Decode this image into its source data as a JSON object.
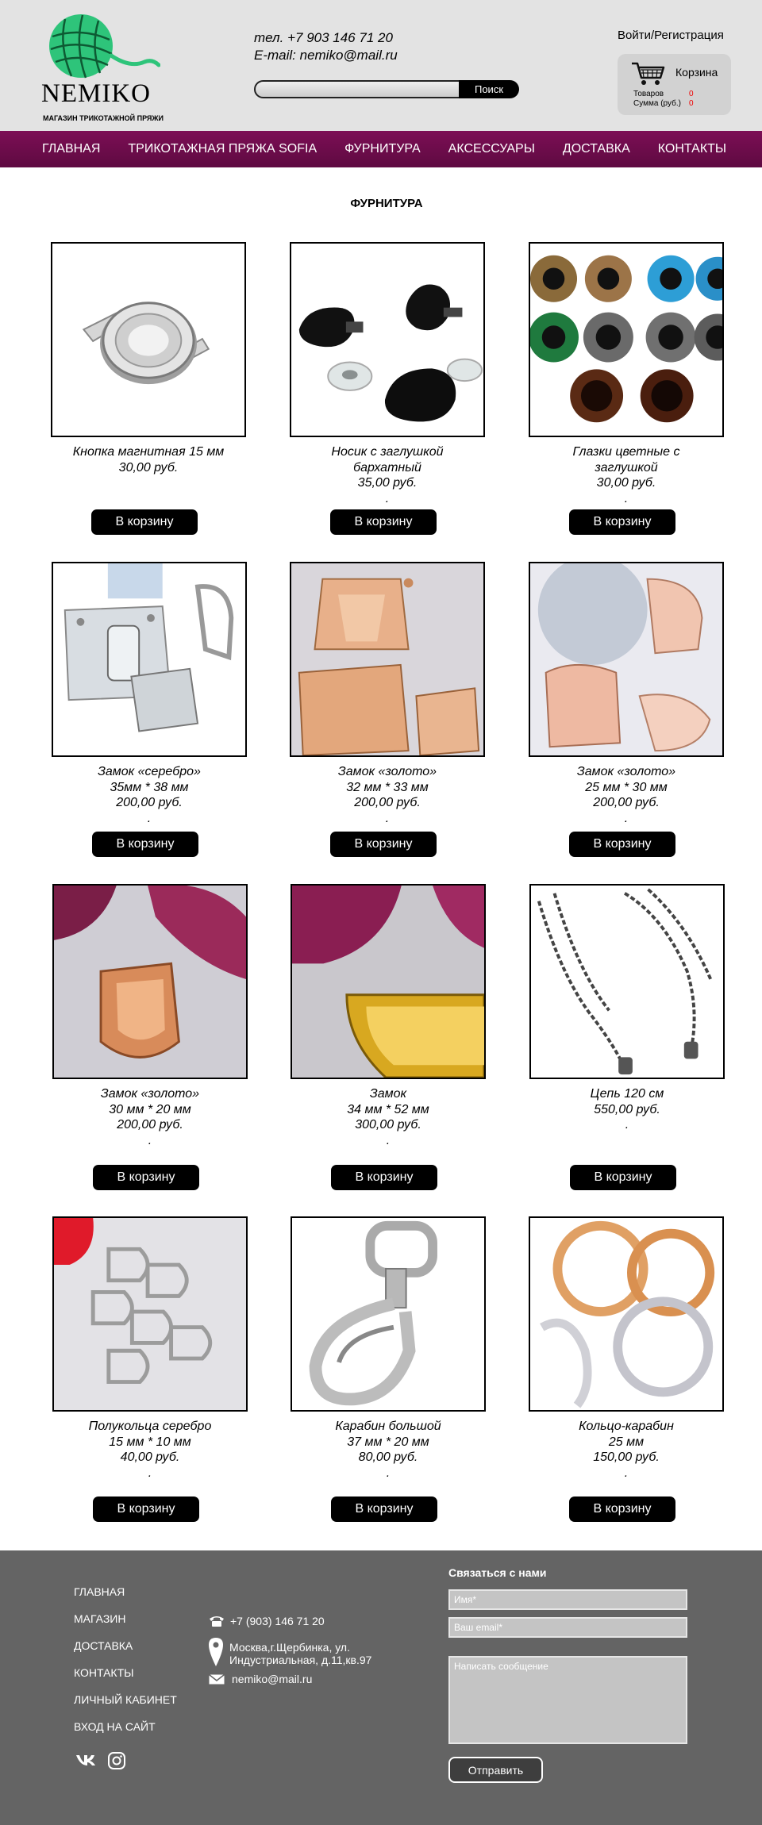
{
  "header": {
    "logo_name": "NEMIKO",
    "logo_sub": "МАГАЗИН ТРИКОТАЖНОЙ ПРЯЖИ",
    "phone": "тел. +7 903 146 71 20",
    "email": "E-mail: nemiko@mail.ru",
    "search_button": "Поиск",
    "search_value": "",
    "login": "Войти/Регистрация",
    "cart": {
      "title": "Корзина",
      "items_label": "Товаров",
      "items_value": "0",
      "sum_label": "Сумма (руб.)",
      "sum_value": "0"
    }
  },
  "nav": [
    "ГЛАВНАЯ",
    "ТРИКОТАЖНАЯ ПРЯЖА SOFIA",
    "ФУРНИТУРА",
    "АКСЕССУАРЫ",
    "ДОСТАВКА",
    "КОНТАКТЫ"
  ],
  "page_title": "ФУРНИТУРА",
  "button_label": "В корзину",
  "products": [
    {
      "lines": [
        "Кнопка магнитная 15 мм",
        "30,00 руб."
      ]
    },
    {
      "lines": [
        "Носик с заглушкой",
        "бархатный",
        "35,00 руб.",
        "."
      ]
    },
    {
      "lines": [
        "Глазки цветные с",
        "заглушкой",
        "30,00 руб.",
        "."
      ]
    },
    {
      "lines": [
        "Замок «серебро»",
        "35мм * 38 мм",
        "200,00 руб.",
        "."
      ]
    },
    {
      "lines": [
        "Замок «золото»",
        "32 мм * 33 мм",
        "200,00 руб.",
        "."
      ]
    },
    {
      "lines": [
        "Замок «золото»",
        "25 мм * 30 мм",
        "200,00 руб.",
        "."
      ]
    },
    {
      "lines": [
        "Замок «золото»",
        "30 мм * 20 мм",
        "200,00 руб.",
        "."
      ]
    },
    {
      "lines": [
        "Замок",
        "34 мм * 52 мм",
        "300,00 руб.",
        "."
      ]
    },
    {
      "lines": [
        "Цепь 120 см",
        "550,00 руб.",
        "."
      ]
    },
    {
      "lines": [
        "Полукольца серебро",
        "15 мм * 10 мм",
        "40,00 руб.",
        "."
      ]
    },
    {
      "lines": [
        "Карабин большой",
        "37 мм * 20 мм",
        "80,00 руб.",
        "."
      ]
    },
    {
      "lines": [
        "Кольцо-карабин",
        "25 мм",
        "150,00 руб.",
        "."
      ]
    }
  ],
  "footer": {
    "nav": [
      "ГЛАВНАЯ",
      "МАГАЗИН",
      "ДОСТАВКА",
      "КОНТАКТЫ",
      "ЛИЧНЫЙ КАБИНЕТ",
      "ВХОД НА САЙТ"
    ],
    "phone": "+7 (903) 146 71 20",
    "address_line1": "Москва,г.Щербинка, ул.",
    "address_line2": "Индустриальная, д.11,кв.97",
    "email": "nemiko@mail.ru",
    "form_title": "Связаться с нами",
    "name_placeholder": "Имя*",
    "email_placeholder": "Ваш email*",
    "message_placeholder": "Написать сообщение",
    "send_button": "Отправить"
  },
  "colors": {
    "nav": "#6d0c4c",
    "logo_ball": "#2ec47a",
    "footer": "#646464",
    "cart_count": "#e00000"
  }
}
